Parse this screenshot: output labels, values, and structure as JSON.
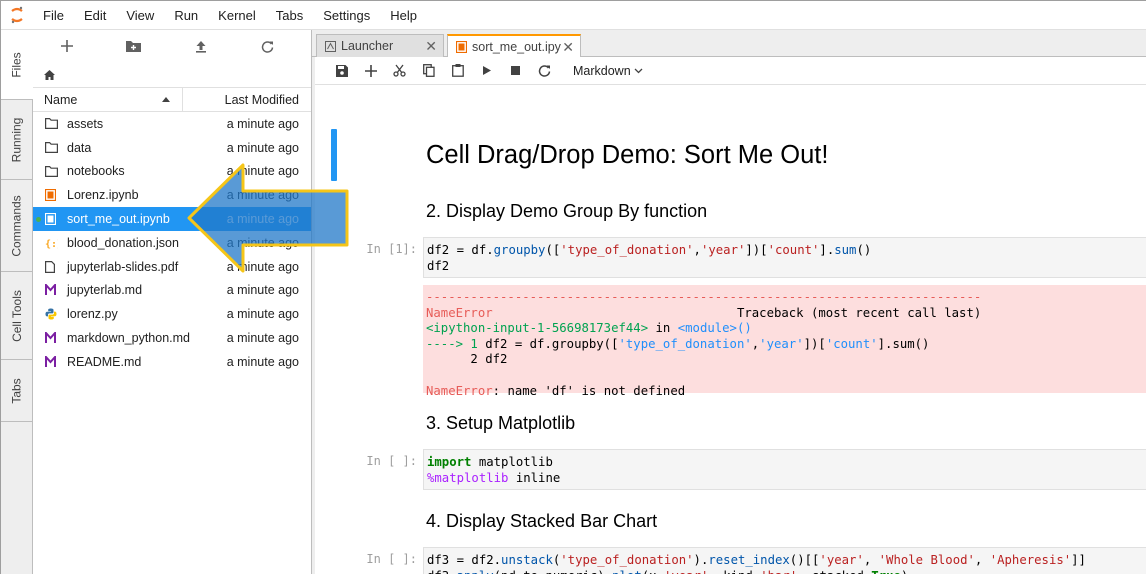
{
  "menubar": {
    "items": [
      "File",
      "Edit",
      "View",
      "Run",
      "Kernel",
      "Tabs",
      "Settings",
      "Help"
    ]
  },
  "left_tabs": [
    "Files",
    "Running",
    "Commands",
    "Cell Tools",
    "Tabs"
  ],
  "filebrowser": {
    "toolbar_icons": [
      "plus-icon",
      "new-folder-icon",
      "upload-icon",
      "refresh-icon"
    ],
    "breadcrumb_icon": "home-icon",
    "columns": {
      "name": "Name",
      "modified": "Last Modified"
    },
    "files": [
      {
        "name": "assets",
        "modified": "a minute ago",
        "icon": "folder-icon"
      },
      {
        "name": "data",
        "modified": "a minute ago",
        "icon": "folder-icon"
      },
      {
        "name": "notebooks",
        "modified": "a minute ago",
        "icon": "folder-icon"
      },
      {
        "name": "Lorenz.ipynb",
        "modified": "a minute ago",
        "icon": "notebook-icon"
      },
      {
        "name": "sort_me_out.ipynb",
        "modified": "a minute ago",
        "icon": "notebook-icon"
      },
      {
        "name": "blood_donation.json",
        "modified": "a minute ago",
        "icon": "json-icon"
      },
      {
        "name": "jupyterlab-slides.pdf",
        "modified": "a minute ago",
        "icon": "file-icon"
      },
      {
        "name": "jupyterlab.md",
        "modified": "a minute ago",
        "icon": "markdown-icon"
      },
      {
        "name": "lorenz.py",
        "modified": "a minute ago",
        "icon": "python-icon"
      },
      {
        "name": "markdown_python.md",
        "modified": "a minute ago",
        "icon": "markdown-icon"
      },
      {
        "name": "README.md",
        "modified": "a minute ago",
        "icon": "markdown-icon"
      }
    ],
    "selected_index": 4
  },
  "tabs": [
    {
      "label": "Launcher",
      "icon": "launcher-icon"
    },
    {
      "label": "sort_me_out.ipy",
      "icon": "notebook-icon"
    }
  ],
  "notebook": {
    "toolbar_icons": [
      "save-icon",
      "add-cell-icon",
      "cut-icon",
      "copy-icon",
      "paste-icon",
      "run-icon",
      "stop-icon",
      "restart-icon"
    ],
    "cell_type": "Markdown",
    "title": "Cell Drag/Drop Demo: Sort Me Out!",
    "sections": [
      "2. Display Demo Group By function",
      "3. Setup Matplotlib",
      "4. Display Stacked Bar Chart"
    ],
    "prompts": [
      "In [1]:",
      "In [ ]:",
      "In [ ]:"
    ],
    "error": {
      "dashes": "---------------------------------------------------------------------------",
      "name": "NameError",
      "traceback_label": "Traceback (most recent call last)",
      "location": "<ipython-input-1-56698173ef44>",
      "in_word": "in",
      "module": "<module>()",
      "arrow_line_prefix": "----> 1",
      "line_2": "      2 df2",
      "message": ": name 'df' is not defined"
    }
  }
}
